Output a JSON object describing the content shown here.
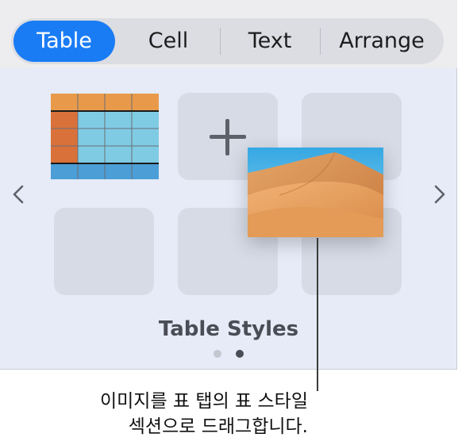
{
  "tabs": [
    {
      "label": "Table",
      "active": true
    },
    {
      "label": "Cell",
      "active": false
    },
    {
      "label": "Text",
      "active": false
    },
    {
      "label": "Arrange",
      "active": false
    }
  ],
  "section": {
    "title": "Table Styles",
    "page_indicator": {
      "pages": 2,
      "current": 2
    }
  },
  "icons": {
    "add": "plus-icon",
    "prev": "chevron-left-icon",
    "next": "chevron-right-icon"
  },
  "drag_image": {
    "subject": "desert sand dunes"
  },
  "callout": {
    "line1": "이미지를 표 탭의 표 스타일",
    "line2": "섹션으로 드래그합니다."
  },
  "colors": {
    "accent": "#1a7cf5",
    "panel_bg": "#e6ebf7",
    "slot_bg": "#d6dbe6",
    "table_header": "#e89a4a",
    "table_body": "#7fcbe4",
    "table_footer": "#4b9ed6",
    "table_side": "#d9713a"
  }
}
